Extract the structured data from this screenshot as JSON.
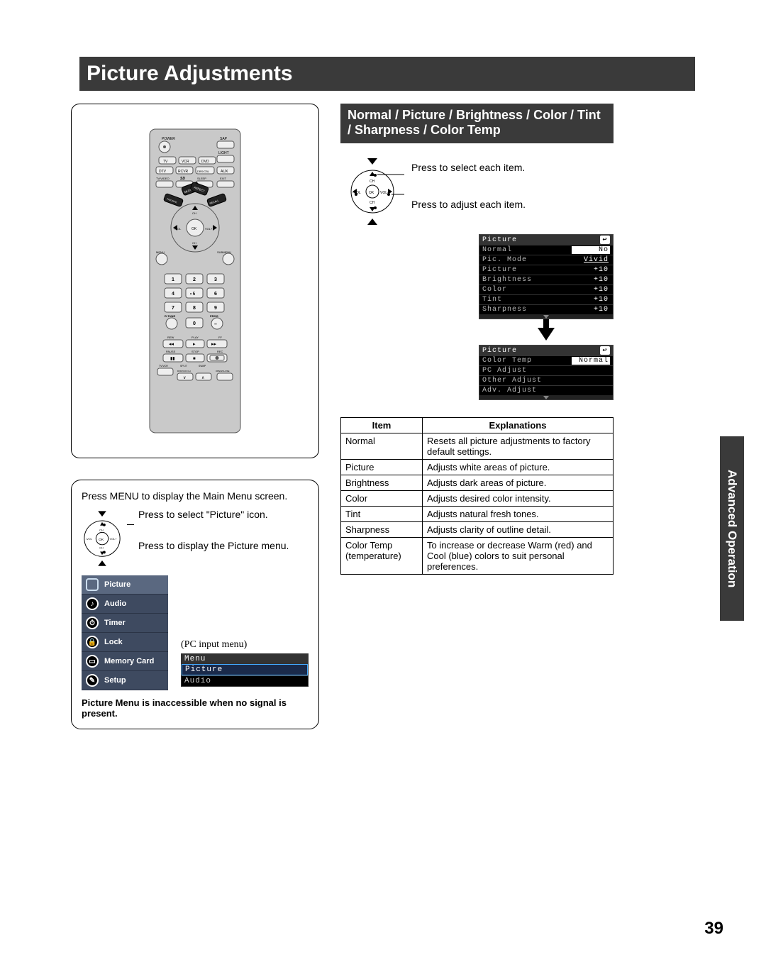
{
  "page_title": "Picture Adjustments",
  "side_tab": "Advanced Operation",
  "page_number": "39",
  "left": {
    "menu_instruction": "Press MENU to display the Main Menu screen.",
    "select_text": "Press to select \"Picture\" icon.",
    "display_text": "Press to display the Picture menu.",
    "main_menu": [
      "Picture",
      "Audio",
      "Timer",
      "Lock",
      "Memory Card",
      "Setup"
    ],
    "pc_input_label": "(PC input menu)",
    "pc_menu_header": "Menu",
    "pc_menu_items": [
      "Picture",
      "Audio"
    ],
    "note": "Picture Menu is inaccessible when no signal is present."
  },
  "right": {
    "banner": "Normal / Picture / Brightness / Color / Tint / Sharpness / Color Temp",
    "select_item": "Press to select each item.",
    "adjust_item": "Press to adjust each item.",
    "osd1": {
      "title": "Picture",
      "rows": [
        {
          "label": "Normal",
          "value": "No"
        },
        {
          "label": "Pic. Mode",
          "value": "Vivid"
        },
        {
          "label": "Picture",
          "value": "+10"
        },
        {
          "label": "Brightness",
          "value": "+10"
        },
        {
          "label": "Color",
          "value": "+10"
        },
        {
          "label": "Tint",
          "value": "+10"
        },
        {
          "label": "Sharpness",
          "value": "+10"
        }
      ]
    },
    "osd2": {
      "title": "Picture",
      "rows": [
        {
          "label": "Color Temp",
          "value": "Normal"
        },
        {
          "label": "PC Adjust",
          "value": ""
        },
        {
          "label": "Other Adjust",
          "value": ""
        },
        {
          "label": "Adv. Adjust",
          "value": ""
        }
      ]
    },
    "table": {
      "head": [
        "Item",
        "Explanations"
      ],
      "rows": [
        [
          "Normal",
          "Resets all picture adjustments to factory default settings."
        ],
        [
          "Picture",
          "Adjusts white areas of picture."
        ],
        [
          "Brightness",
          "Adjusts dark areas of picture."
        ],
        [
          "Color",
          "Adjusts desired color intensity."
        ],
        [
          "Tint",
          "Adjusts natural fresh tones."
        ],
        [
          "Sharpness",
          "Adjusts clarity of outline detail."
        ],
        [
          "Color Temp (temperature)",
          "To increase or decrease Warm (red) and Cool (blue) colors to suit personal preferences."
        ]
      ]
    }
  },
  "remote_labels": {
    "power": "POWER",
    "sap": "SAP",
    "light": "LIGHT",
    "tv": "TV",
    "vcr": "VCR",
    "dvd": "DVD",
    "dtv": "DTV",
    "rcvr": "RCVR",
    "dbs": "DBS/CBL",
    "aux": "AUX",
    "tvvideo": "TV/VIDEO",
    "sd": "SD",
    "sleep": "SLEEP",
    "exit": "EXIT",
    "mute": "MUTE",
    "aspect": "ASPECT",
    "favorite": "FAVORITE",
    "recall": "RECALL",
    "ch_up": "CH",
    "ch_dn": "CH",
    "vol_m": "-VOL",
    "vol_p": "VOL+",
    "ok": "OK",
    "menu": "MENU",
    "submenu": "SUBMENU",
    "rtune": "R-TUNE",
    "prog": "PROG",
    "rew": "REW",
    "play": "PLAY",
    "ff": "FF",
    "pause": "PAUSE",
    "stop": "STOP",
    "rec": "REC",
    "tvvcr2": "TV/VCR",
    "split": "SPLIT",
    "swap": "SWAP",
    "dvdvcrch": "DVD/VCR CH",
    "openclose": "OPEN/CLOSE"
  },
  "nav_labels": {
    "ch": "CH",
    "volm": "-VOL",
    "volp": "VOL +",
    "ok": "OK"
  }
}
